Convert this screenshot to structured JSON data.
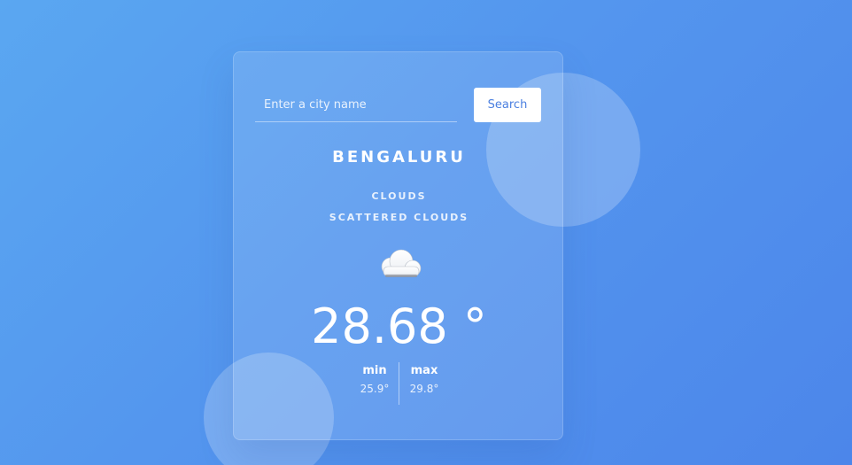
{
  "search": {
    "placeholder": "Enter a city name",
    "value": "",
    "button_label": "Search"
  },
  "weather": {
    "city": "BENGALURU",
    "main": "CLOUDS",
    "description": "SCATTERED CLOUDS",
    "icon": "cloud-icon",
    "temperature": "28.68 °",
    "min_label": "min",
    "min_value": "25.9°",
    "max_label": "max",
    "max_value": "29.8°"
  },
  "colors": {
    "background_start": "#5aa7f1",
    "background_end": "#4c86ea",
    "accent": "#4a7fe0",
    "text": "#ffffff"
  }
}
